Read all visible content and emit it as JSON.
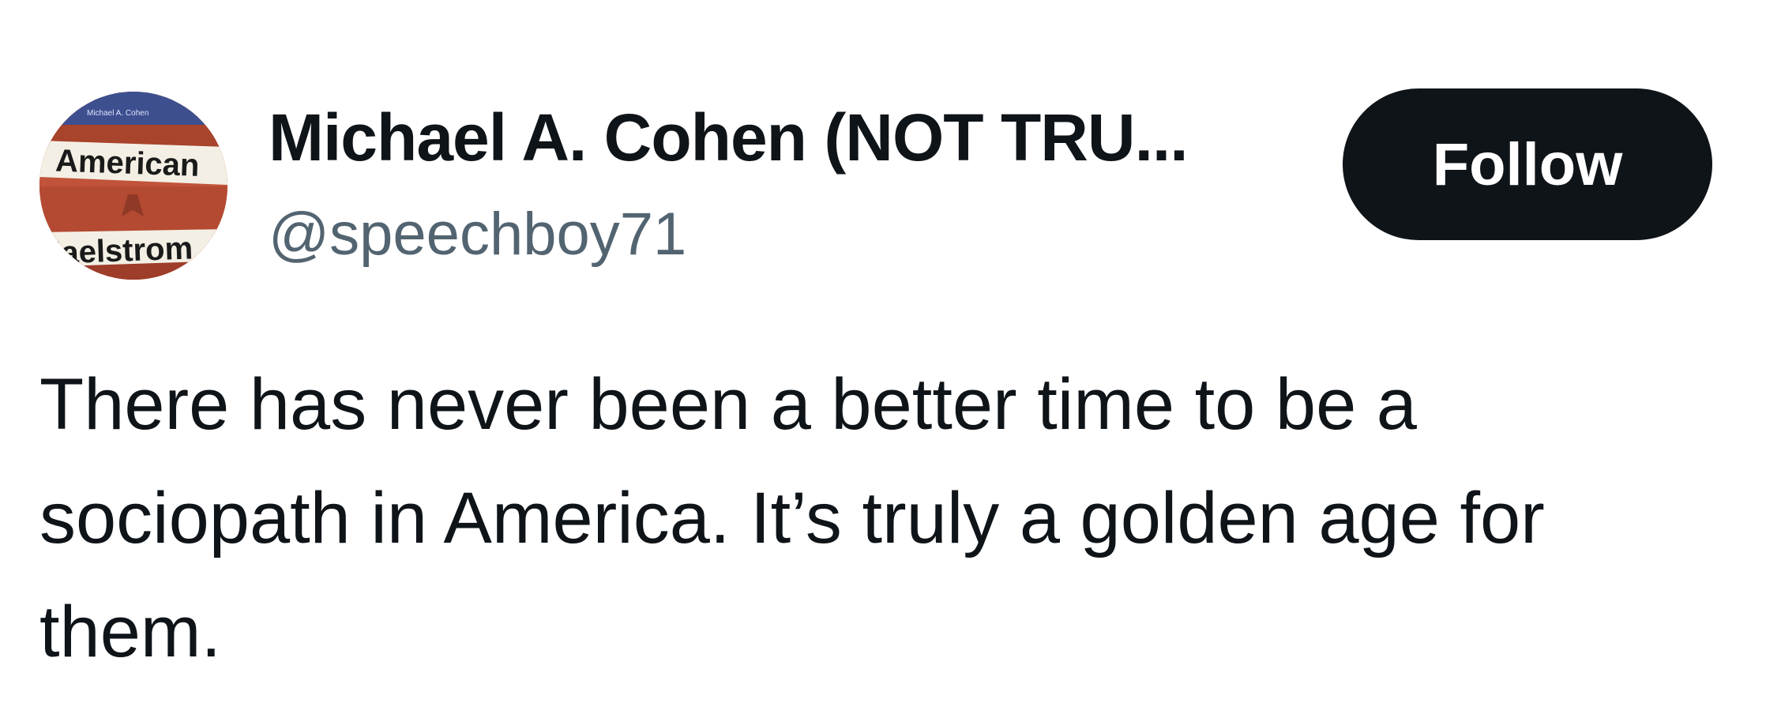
{
  "author": {
    "display_name": "Michael A. Cohen (NOT TRU...",
    "handle": "@speechboy71",
    "avatar": {
      "description_icon": "book-cover-avatar",
      "cover_title_line1": "American",
      "cover_title_line2": "Maelstrom",
      "cover_author": "Michael A. Cohen"
    }
  },
  "actions": {
    "follow_label": "Follow"
  },
  "tweet": {
    "text": "There has never been a better time to be a sociopath in America. It’s truly a golden age for them."
  },
  "colors": {
    "text_primary": "#0f1419",
    "text_secondary": "#536471",
    "button_bg": "#0f1419",
    "button_text": "#ffffff",
    "background": "#ffffff"
  }
}
